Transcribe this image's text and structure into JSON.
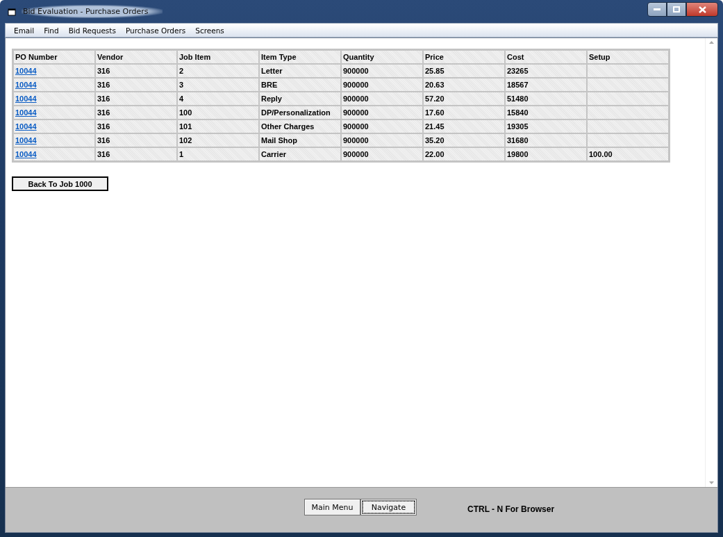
{
  "window": {
    "title": "Bid Evaluation - Purchase Orders"
  },
  "menu": [
    "Email",
    "Find",
    "Bid Requests",
    "Purchase Orders",
    "Screens"
  ],
  "table": {
    "columns": [
      "PO Number",
      "Vendor",
      "Job Item",
      "Item Type",
      "Quantity",
      "Price",
      "Cost",
      "Setup"
    ],
    "rows": [
      [
        "10044",
        "316",
        "2",
        "Letter",
        "900000",
        "25.85",
        "23265",
        ""
      ],
      [
        "10044",
        "316",
        "3",
        "BRE",
        "900000",
        "20.63",
        "18567",
        ""
      ],
      [
        "10044",
        "316",
        "4",
        "Reply",
        "900000",
        "57.20",
        "51480",
        ""
      ],
      [
        "10044",
        "316",
        "100",
        "DP/Personalization",
        "900000",
        "17.60",
        "15840",
        ""
      ],
      [
        "10044",
        "316",
        "101",
        "Other Charges",
        "900000",
        "21.45",
        "19305",
        ""
      ],
      [
        "10044",
        "316",
        "102",
        "Mail Shop",
        "900000",
        "35.20",
        "31680",
        ""
      ],
      [
        "10044",
        "316",
        "1",
        "Carrier",
        "900000",
        "22.00",
        "19800",
        "100.00"
      ]
    ]
  },
  "back_button": "Back To Job 1000",
  "footer": {
    "buttons": [
      {
        "label": "Main Menu",
        "focused": false
      },
      {
        "label": "Navigate",
        "focused": true
      }
    ],
    "hint": "CTRL - N For Browser"
  }
}
